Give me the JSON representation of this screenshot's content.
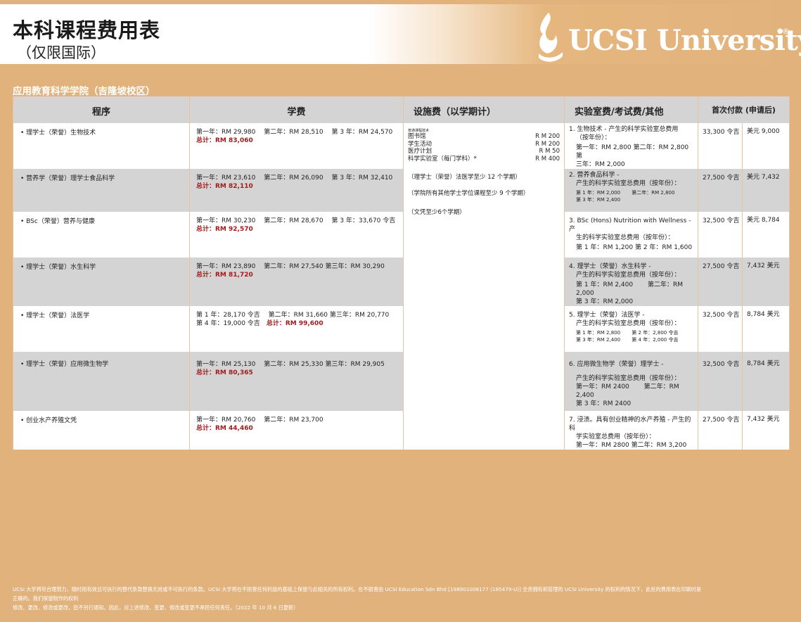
{
  "header": {
    "title": "本科课程费用表",
    "subtitle": "（仅限国际）",
    "logo_text": "UCSI University",
    "logo_reg": "®"
  },
  "school": "应用教育科学学院（吉隆坡校区）",
  "columns": [
    "程序",
    "学费",
    "设施费（以学期计）",
    "实验室费/考试费/其他",
    "首次付款 (申请后)"
  ],
  "facilities": {
    "tiny_label": "普通课程技术",
    "items": [
      {
        "label": "图书馆",
        "amount": "R M  200"
      },
      {
        "label": "学生活动",
        "amount": "R M  200"
      },
      {
        "label": "医疗计划",
        "amount": "R M   50"
      },
      {
        "label": "科学实验室（每门学科）*",
        "amount": "R M  400"
      }
    ],
    "notes": [
      "（理学士（荣誉）法医学至少 12 个学期）",
      "（学院所有其他学士学位课程至少 9 个学期）",
      "（文凭至少6个学期）"
    ]
  },
  "programmes": [
    {
      "name": "• 理学士（荣誉）生物技术",
      "tuition": "第一年：RM 29,980　 第二年：RM 28,510　 第 3 年：RM 24,570",
      "total": "总计：RM 83,060",
      "lab": [
        "1. 生物技术 - 产生的科学实验室总费用",
        "（按年份）：",
        "第一年：RM 2,800 第二年：RM 2,800 第",
        "三年：RM 2,000"
      ],
      "first_payment": "33,300 令吉",
      "usd": "美元 9,000"
    },
    {
      "name": "• 营养学（荣誉）理学士食品科学",
      "tuition": "第一年：RM 23,610　 第二年：RM 26,090　 第 3 年：RM 32,410",
      "total": "总计：RM 82,110",
      "lab": [
        "2. 营养食品科学 -",
        "产生的科学实验室总费用（按年份）：",
        "第 1 年：RM 2,000　　 第二年：RM 2,800",
        "第 3 年：RM 2,400"
      ],
      "first_payment": "27,500 令吉",
      "usd": "美元 7,432"
    },
    {
      "name": "• BSc（荣誉）营养与健康",
      "tuition": "第一年：RM 30,230　 第二年：RM 28,670　 第 3 年：33,670 令吉",
      "total": "总计：RM 92,570",
      "lab": [
        "3. BSc (Hons) Nutrition with Wellness - 产",
        "生的科学实验室总费用（按年份）：",
        "第 1 年：RM 1,200 第 2 年：RM 1,600"
      ],
      "first_payment": "32,500 令吉",
      "usd": "美元 8,784"
    },
    {
      "name": "• 理学士（荣誉）水生科学",
      "tuition": "第一年：RM 23,890　 第二年：RM 27,540 第三年：RM 30,290",
      "total": "总计：RM 81,720",
      "lab": [
        "4. 理学士（荣誉）水生科学 -",
        "产生的科学实验室总费用（按年份）：",
        "第 1 年：RM 2,400　　 第二年：RM 2,000",
        "第 3 年：RM 2,000"
      ],
      "first_payment": "27,500 令吉",
      "usd": "7,432 美元"
    },
    {
      "name": "• 理学士（荣誉）法医学",
      "tuition": "第 1 年：28,170 令吉　 第二年：RM 31,660 第三年：RM 20,770",
      "tuition2": "第 4 年：19,000 令吉",
      "total": "总计：RM 99,600",
      "lab": [
        "5. 理学士（荣誉）法医学 -",
        "产生的科学实验室总费用（按年份）：",
        "第 1 年：RM 2,800　　 第 2 年：2,800 令吉",
        "第 3 年：RM 2,400　　 第 4 年：2,000 令吉"
      ],
      "first_payment": "32,500 令吉",
      "usd": "8,784 美元"
    },
    {
      "name": "• 理学士（荣誉）应用微生物学",
      "tuition": "第一年：RM 25,130　 第二年：RM 25,330 第三年：RM 29,905",
      "total": "总计：RM 80,365",
      "lab": [
        "6. 应用微生物学（荣誉）理学士 -",
        "",
        "产生的科学实验室总费用（按年份）：",
        "第一年：RM 2400　　 第二年：RM 2,400",
        "第 3 年：RM 2400"
      ],
      "first_payment": "32,500 令吉",
      "usd": "8,784 美元"
    },
    {
      "name": "• 创业水产养殖文凭",
      "tuition": "第一年：RM 20,760　 第二年：RM 23,700",
      "total": "总计：RM 44,460",
      "lab": [
        "7. 浸渍。具有创业精神的水产养殖 - 产生的科",
        "学实验室总费用（按年份）：",
        "第一年：RM 2800 第二年：RM 3,200"
      ],
      "first_payment": "27,500 令吉",
      "usd": "7,432 美元"
    }
  ],
  "footer": {
    "line1": "UCSI 大学将尽合理努力，随时用有效且可执行的替代条款替换无效或不可执行的条款。UCSI 大学将在不损害任何利益的基础上保留与此相关的所有权利。在不损害由 UCSI Education Sdn Bhd [198901008177 (185479-U)] 全资拥有和管理的 UCSI University 的权利的情况下，此处的费用表在印刷时是",
    "line2": "正确的。我们保留制作的权利",
    "line3": "修改、更改、修改或更改，恕不另行通知。因此，对上述修改、变更、修改或变更不承担任何责任。（2022 年 10 月 6 日更新）"
  }
}
